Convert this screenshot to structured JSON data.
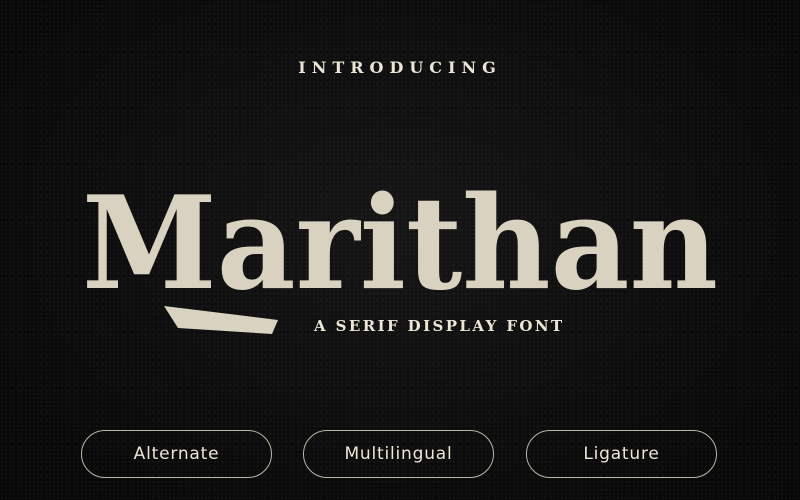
{
  "intro_label": "INTRODUCING",
  "font_name": "Marithan",
  "tagline": "A SERIF DISPLAY FONT",
  "features": [
    "Alternate",
    "Multilingual",
    "Ligature"
  ],
  "colors": {
    "background": "#0c0c0c",
    "wordmark": "#d9d2c0",
    "text": "#ece6d6",
    "pill_border": "#bdb6a6"
  }
}
